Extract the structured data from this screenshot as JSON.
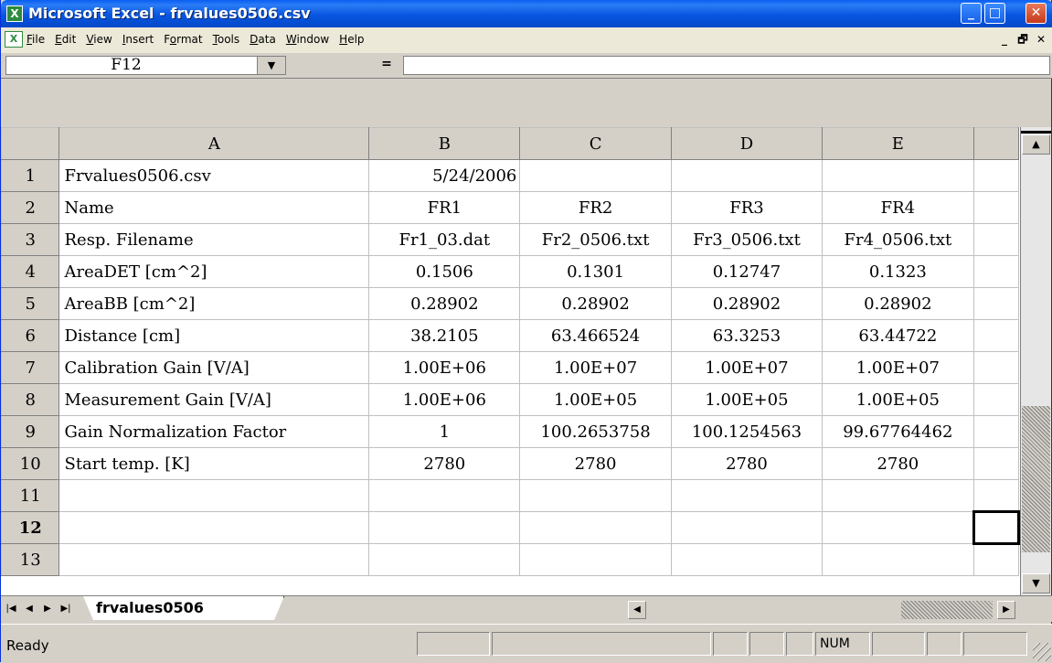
{
  "window": {
    "title": "Microsoft Excel - frvalues0506.csv",
    "app_icon": "excel-icon",
    "minimize_label": "_",
    "maximize_label": "□",
    "close_label": "✕"
  },
  "menu": {
    "items": [
      {
        "pre": "",
        "key": "F",
        "post": "ile"
      },
      {
        "pre": "",
        "key": "E",
        "post": "dit"
      },
      {
        "pre": "",
        "key": "V",
        "post": "iew"
      },
      {
        "pre": "",
        "key": "I",
        "post": "nsert"
      },
      {
        "pre": "F",
        "key": "o",
        "post": "rmat"
      },
      {
        "pre": "",
        "key": "T",
        "post": "ools"
      },
      {
        "pre": "",
        "key": "D",
        "post": "ata"
      },
      {
        "pre": "",
        "key": "W",
        "post": "indow"
      },
      {
        "pre": "",
        "key": "H",
        "post": "elp"
      }
    ],
    "doc_min": "_",
    "doc_restore": "🗗",
    "doc_close": "✕"
  },
  "formula_bar": {
    "name_box": "F12",
    "equals": "=",
    "formula": ""
  },
  "sheet": {
    "columns": [
      "A",
      "B",
      "C",
      "D",
      "E"
    ],
    "rows": [
      {
        "num": "1",
        "cells": [
          "Frvalues0506.csv",
          "5/24/2006",
          "",
          "",
          ""
        ]
      },
      {
        "num": "2",
        "cells": [
          "Name",
          "FR1",
          "FR2",
          "FR3",
          "FR4"
        ]
      },
      {
        "num": "3",
        "cells": [
          "Resp. Filename",
          "Fr1_03.dat",
          "Fr2_0506.txt",
          "Fr3_0506.txt",
          "Fr4_0506.txt"
        ]
      },
      {
        "num": "4",
        "cells": [
          "AreaDET [cm^2]",
          "0.1506",
          "0.1301",
          "0.12747",
          "0.1323"
        ]
      },
      {
        "num": "5",
        "cells": [
          "AreaBB [cm^2]",
          "0.28902",
          "0.28902",
          "0.28902",
          "0.28902"
        ]
      },
      {
        "num": "6",
        "cells": [
          "Distance [cm]",
          "38.2105",
          "63.466524",
          "63.3253",
          "63.44722"
        ]
      },
      {
        "num": "7",
        "cells": [
          "Calibration Gain [V/A]",
          "1.00E+06",
          "1.00E+07",
          "1.00E+07",
          "1.00E+07"
        ]
      },
      {
        "num": "8",
        "cells": [
          "Measurement Gain [V/A]",
          "1.00E+06",
          "1.00E+05",
          "1.00E+05",
          "1.00E+05"
        ]
      },
      {
        "num": "9",
        "cells": [
          "Gain Normalization Factor",
          "1",
          "100.2653758",
          "100.1254563",
          "99.67764462"
        ]
      },
      {
        "num": "10",
        "cells": [
          "Start temp. [K]",
          "2780",
          "2780",
          "2780",
          "2780"
        ]
      },
      {
        "num": "11",
        "cells": [
          "",
          "",
          "",
          "",
          ""
        ]
      },
      {
        "num": "12",
        "cells": [
          "",
          "",
          "",
          "",
          ""
        ]
      },
      {
        "num": "13",
        "cells": [
          "",
          "",
          "",
          "",
          ""
        ]
      }
    ],
    "selected_row": "12",
    "tab_name": "frvalues0506"
  },
  "status": {
    "text": "Ready",
    "num": "NUM"
  }
}
